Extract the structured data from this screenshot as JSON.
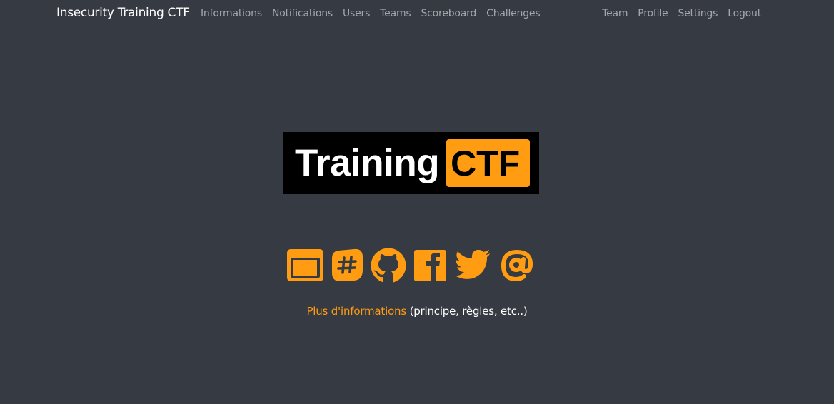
{
  "navbar": {
    "brand": "Insecurity Training CTF",
    "left_links": [
      "Informations",
      "Notifications",
      "Users",
      "Teams",
      "Scoreboard",
      "Challenges"
    ],
    "right_links": [
      "Team",
      "Profile",
      "Settings",
      "Logout"
    ]
  },
  "logo": {
    "word": "Training",
    "box_word": "CTF"
  },
  "social_icons": [
    "window-icon",
    "slack-icon",
    "github-icon",
    "facebook-icon",
    "twitter-icon",
    "at-email-icon"
  ],
  "info": {
    "link_text": "Plus d'informations",
    "suffix": "(principe, règles, etc..)"
  },
  "colors": {
    "background": "#363a42",
    "accent": "#ff9c11",
    "nav_text": "#a3a6ab",
    "logo_background": "#000000"
  }
}
